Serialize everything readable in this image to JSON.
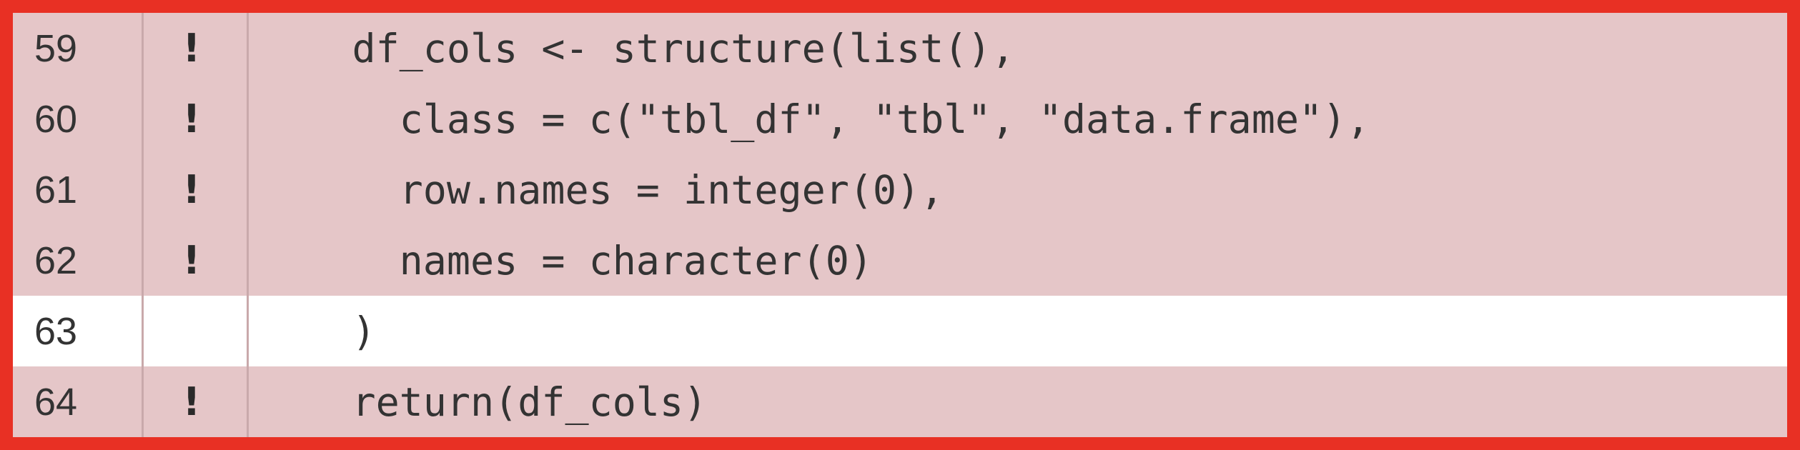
{
  "colors": {
    "frame_border": "#e83024",
    "uncovered_bg": "#e5c6c8",
    "covered_bg": "#ffffff",
    "text": "#333333"
  },
  "lines": [
    {
      "number": "59",
      "marker": "!",
      "code": "    df_cols <- structure(list(),",
      "status": "uncovered"
    },
    {
      "number": "60",
      "marker": "!",
      "code": "      class = c(\"tbl_df\", \"tbl\", \"data.frame\"),",
      "status": "uncovered"
    },
    {
      "number": "61",
      "marker": "!",
      "code": "      row.names = integer(0),",
      "status": "uncovered"
    },
    {
      "number": "62",
      "marker": "!",
      "code": "      names = character(0)",
      "status": "uncovered"
    },
    {
      "number": "63",
      "marker": "",
      "code": "    )",
      "status": "covered"
    },
    {
      "number": "64",
      "marker": "!",
      "code": "    return(df_cols)",
      "status": "uncovered"
    }
  ]
}
